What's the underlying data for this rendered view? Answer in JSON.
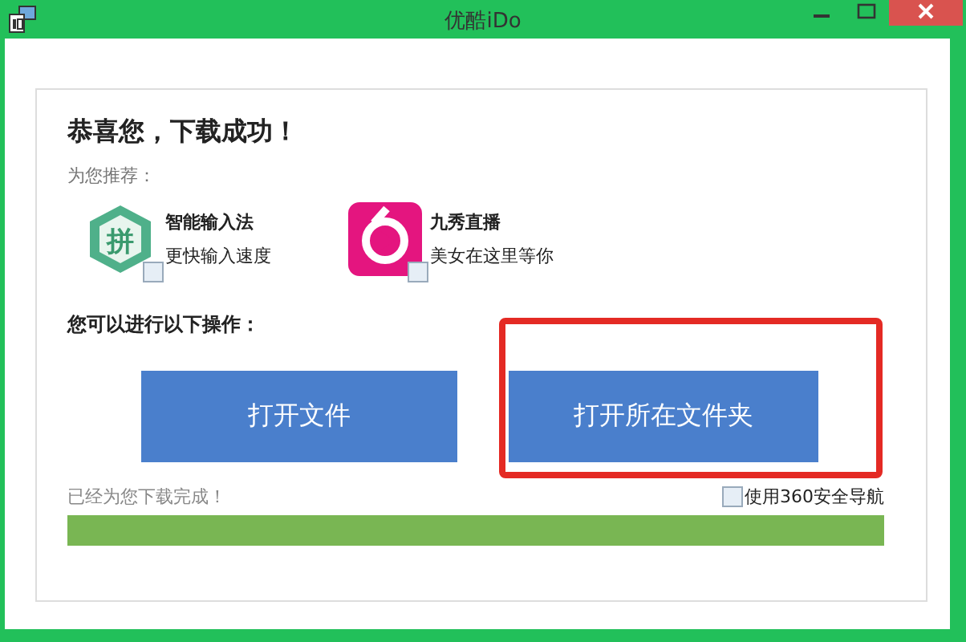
{
  "window": {
    "title": "优酷iDo"
  },
  "heading": "恭喜您，下载成功！",
  "recommend_label": "为您推荐：",
  "recommendations": [
    {
      "kind": "pinyin",
      "logo_text": "拼",
      "name": "智能输入法",
      "description": "更快输入速度",
      "checked": false
    },
    {
      "kind": "live",
      "name": "九秀直播",
      "description": "美女在这里等你",
      "checked": false
    }
  ],
  "actions_label": "您可以进行以下操作：",
  "buttons": [
    {
      "label": "打开文件",
      "highlighted": false
    },
    {
      "label": "打开所在文件夹",
      "highlighted": true
    }
  ],
  "status": "已经为您下载完成！",
  "option": {
    "label": "使用360安全导航",
    "checked": false
  },
  "progress": {
    "level": 1
  }
}
